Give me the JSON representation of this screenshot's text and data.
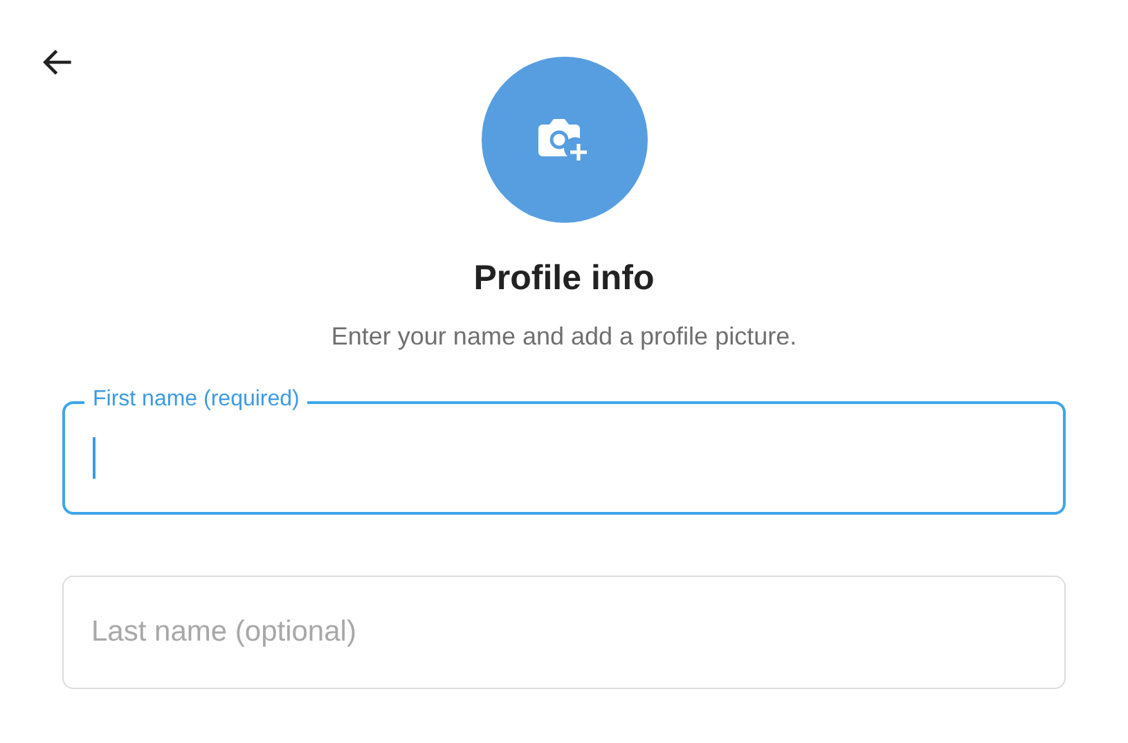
{
  "title": "Profile info",
  "subtitle": "Enter your name and add a profile picture.",
  "fields": [
    {
      "placeholder": "First name (required)",
      "focused": true
    },
    {
      "placeholder": "Last name (optional)",
      "focused": false
    }
  ]
}
